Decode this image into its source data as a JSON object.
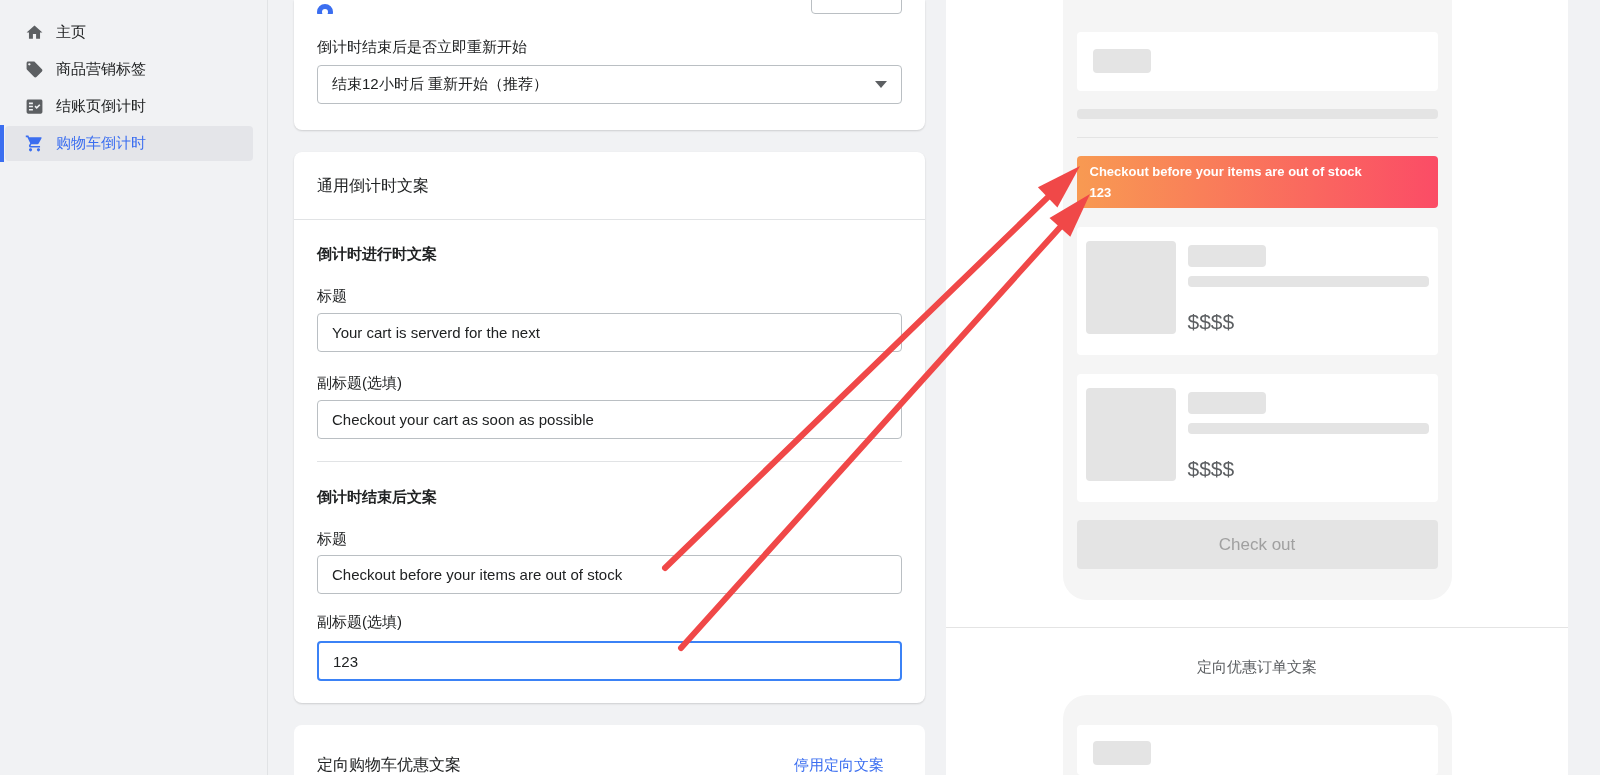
{
  "sidebar": {
    "items": [
      {
        "label": "主页",
        "kind": "home",
        "selected": false
      },
      {
        "label": "商品营销标签",
        "kind": "tag",
        "selected": false
      },
      {
        "label": "结账页倒计时",
        "kind": "checklist",
        "selected": false
      },
      {
        "label": "购物车倒计时",
        "kind": "cart",
        "selected": true
      }
    ]
  },
  "restart_card": {
    "radio_selected": true,
    "label": "倒计时结束后是否立即重新开始",
    "select_value": "结束12小时后 重新开始（推荐）"
  },
  "copy_card": {
    "title": "通用倒计时文案",
    "sections": [
      {
        "title": "倒计时进行时文案",
        "fields": [
          {
            "label": "标题",
            "value": "Your cart is serverd for the next",
            "focused": false
          },
          {
            "label": "副标题(选填)",
            "value": "Checkout your cart as soon as possible",
            "focused": false
          }
        ]
      },
      {
        "title": "倒计时结束后文案",
        "fields": [
          {
            "label": "标题",
            "value": "Checkout before your items are out of stock",
            "focused": false
          },
          {
            "label": "副标题(选填)",
            "value": "123",
            "focused": true
          }
        ]
      }
    ]
  },
  "targeted_card": {
    "title": "定向购物车优惠文案",
    "link": "停用定向文案"
  },
  "preview": {
    "banner": {
      "title": "Checkout before your items are out of stock",
      "subtitle": "123"
    },
    "products": [
      {
        "price": "$$$$"
      },
      {
        "price": "$$$$"
      }
    ],
    "checkout_button": "Check out",
    "second_title": "定向优惠订单文案"
  }
}
